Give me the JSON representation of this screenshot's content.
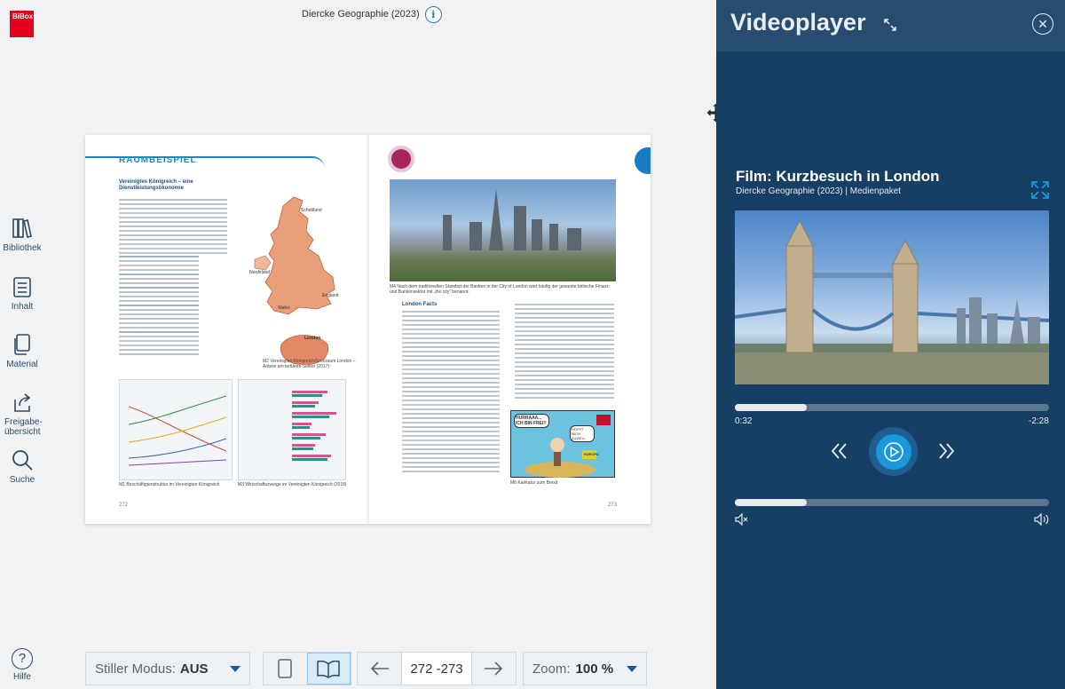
{
  "brand": {
    "logo_text": "BiBox"
  },
  "header": {
    "book_title": "Diercke Geographie (2023)"
  },
  "sidebar": {
    "items": [
      {
        "label": "Bibliothek"
      },
      {
        "label": "Inhalt"
      },
      {
        "label": "Material"
      },
      {
        "label": "Freigabe-übersicht"
      },
      {
        "label": "Suche"
      }
    ],
    "help": "Hilfe"
  },
  "book": {
    "left_banner": "RAUMBEISPIEL",
    "left_heading": "Vereinigtes Königreich – eine Dienstleistungsökonomie",
    "map_labels": [
      "Schottland",
      "Nordirland",
      "England",
      "Wales",
      "London"
    ],
    "left_captions": [
      "M1 Beschäftigtenstruktur im Vereinigten Königreich",
      "M3 Wirtschaftszweige im Vereinigten Königreich (2018)"
    ],
    "map_caption": "M2 Vereinigtes Königreich/Großraum London – Anteile am tertiären Sektor (2017)",
    "right_heading": "London Facts",
    "photo_caption": "M4 Nach dem traditionellen Standort der Banken in der City of London wird häufig der gesamte britische Finanz- und Bankensektor mit „the city“ benannt.",
    "cartoon_caption": "M6 Karikatur zum Brexit",
    "cartoon_texts": [
      "HURRAAA... ICH BIN FREI!!",
      "HOFFT NICH ZUVIEL!",
      "EUROPA"
    ],
    "page_left": "272",
    "page_right": "273"
  },
  "toolbar": {
    "silent_label": "Stiller Modus:",
    "silent_value": "AUS",
    "page_range": "272 -273",
    "zoom_label": "Zoom:",
    "zoom_value": "100 %"
  },
  "video_panel": {
    "title": "Videoplayer",
    "film_title": "Film: Kurzbesuch in London",
    "film_subtitle": "Diercke Geographie (2023)  |  Medienpaket",
    "time_elapsed": "0:32",
    "time_remaining": "-2:28",
    "progress": 0.23,
    "volume": 0.23
  },
  "colors": {
    "accent": "#1a7dc4",
    "panel_bg": "#173f63",
    "panel_header": "#264c6f",
    "logo_red": "#e3001b"
  }
}
